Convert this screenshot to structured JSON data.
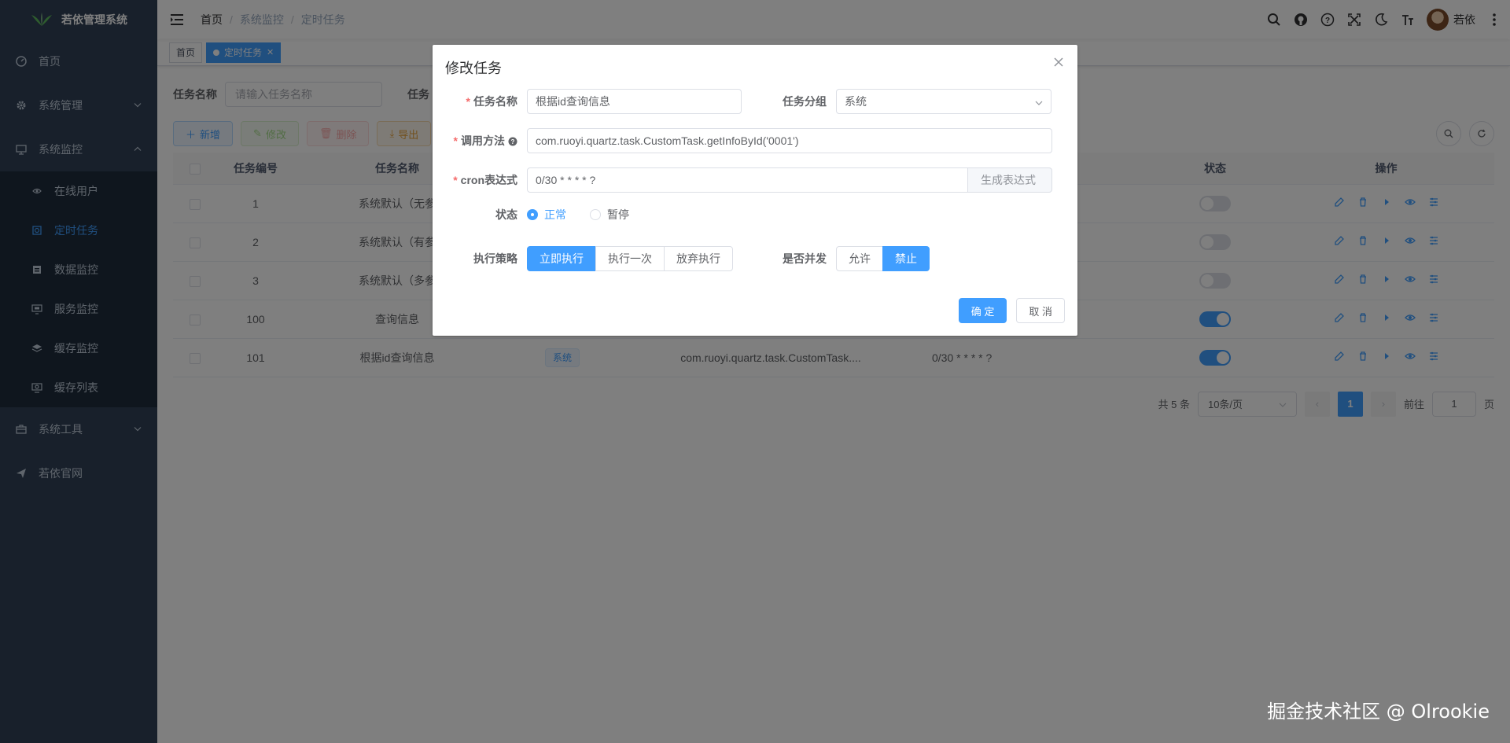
{
  "app": {
    "title": "若依管理系统"
  },
  "sidebar": {
    "items": [
      {
        "label": "首页",
        "icon": "dashboard-icon"
      },
      {
        "label": "系统管理",
        "icon": "gear-icon"
      },
      {
        "label": "系统监控",
        "icon": "monitor-icon"
      },
      {
        "label": "系统工具",
        "icon": "toolbox-icon"
      },
      {
        "label": "若依官网",
        "icon": "send-icon"
      }
    ],
    "monitor_children": [
      {
        "label": "在线用户",
        "icon": "online-icon"
      },
      {
        "label": "定时任务",
        "icon": "job-icon"
      },
      {
        "label": "数据监控",
        "icon": "druid-icon"
      },
      {
        "label": "服务监控",
        "icon": "server-icon"
      },
      {
        "label": "缓存监控",
        "icon": "redis-icon"
      },
      {
        "label": "缓存列表",
        "icon": "redis-list-icon"
      }
    ]
  },
  "navbar": {
    "breadcrumb": [
      "首页",
      "系统监控",
      "定时任务"
    ],
    "username": "若依"
  },
  "tags": [
    "首页",
    "定时任务"
  ],
  "search": {
    "name_label": "任务名称",
    "name_placeholder": "请输入任务名称",
    "group_label": "任务"
  },
  "toolbar": {
    "add": "新增",
    "edit": "修改",
    "delete": "删除",
    "export": "导出"
  },
  "table": {
    "headers": [
      "任务编号",
      "任务名称",
      "状态",
      "操作"
    ],
    "rows": [
      {
        "id": "1",
        "name": "系统默认（无参",
        "group": "",
        "target": "",
        "cron": "",
        "enabled": false
      },
      {
        "id": "2",
        "name": "系统默认（有参",
        "group": "",
        "target": "",
        "cron": "",
        "enabled": false
      },
      {
        "id": "3",
        "name": "系统默认（多参",
        "group": "",
        "target": "",
        "cron": "",
        "enabled": false
      },
      {
        "id": "100",
        "name": "查询信息",
        "group": "",
        "target": "",
        "cron": "",
        "enabled": true
      },
      {
        "id": "101",
        "name": "根据id查询信息",
        "group": "系统",
        "target": "com.ruoyi.quartz.task.CustomTask....",
        "cron": "0/30 * * * * ?",
        "enabled": true
      }
    ]
  },
  "pagination": {
    "total": "共 5 条",
    "page_size": "10条/页",
    "current": "1",
    "goto_label": "前往",
    "goto_value": "1",
    "page_suffix": "页"
  },
  "dialog": {
    "title": "修改任务",
    "name_label": "任务名称",
    "name_value": "根据id查询信息",
    "group_label": "任务分组",
    "group_value": "系统",
    "invoke_label": "调用方法",
    "invoke_value": "com.ruoyi.quartz.task.CustomTask.getInfoById('0001')",
    "cron_label": "cron表达式",
    "cron_value": "0/30 * * * * ?",
    "cron_button": "生成表达式",
    "status_label": "状态",
    "status_options": [
      "正常",
      "暂停"
    ],
    "status_selected": "正常",
    "misfire_label": "执行策略",
    "misfire_options": [
      "立即执行",
      "执行一次",
      "放弃执行"
    ],
    "misfire_selected": "立即执行",
    "concurrent_label": "是否并发",
    "concurrent_options": [
      "允许",
      "禁止"
    ],
    "concurrent_selected": "禁止",
    "confirm": "确 定",
    "cancel": "取 消"
  },
  "watermark": "掘金技术社区 @ Olrookie",
  "colors": {
    "primary": "#409eff",
    "sidebar": "#304156",
    "submenu": "#1f2d3d"
  }
}
